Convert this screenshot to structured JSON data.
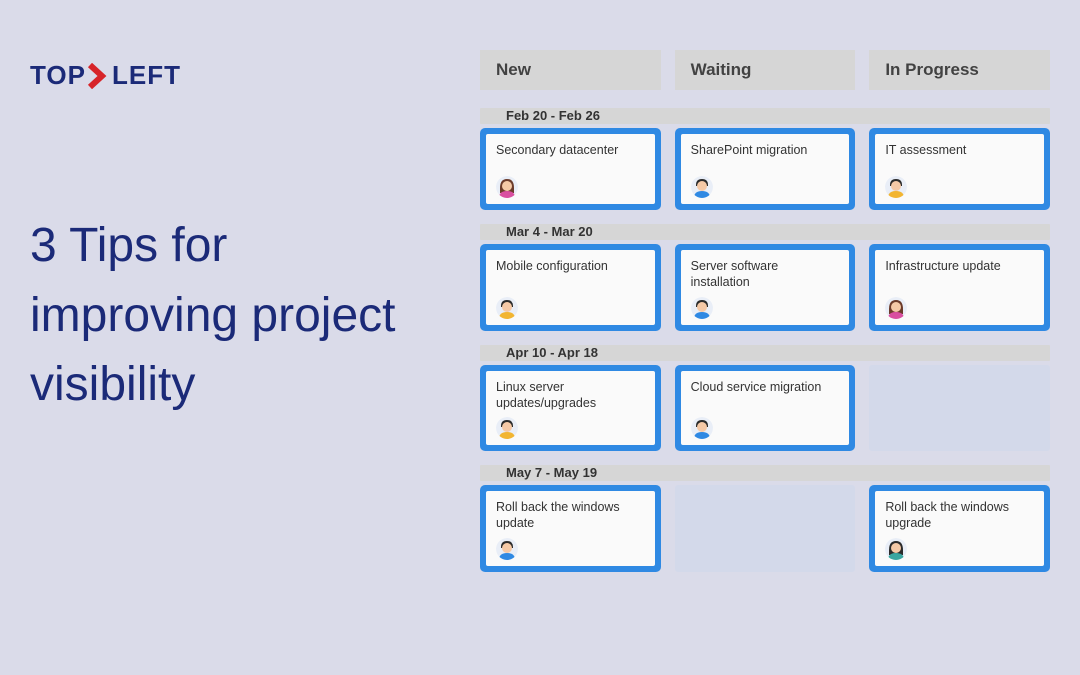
{
  "brand": {
    "top": "TOP",
    "left": "LEFT"
  },
  "headline": "3 Tips for improving project visibility",
  "columns": [
    "New",
    "Waiting",
    "In Progress"
  ],
  "avatars": {
    "woman_brown": {
      "hair": "#6b3b2a",
      "skin": "#f5c9a6",
      "shirt": "#d94fa0"
    },
    "man_blue": {
      "hair": "#2b2b2b",
      "skin": "#f5c9a6",
      "shirt": "#2f89e3"
    },
    "man_yellow": {
      "hair": "#2b2b2b",
      "skin": "#f5c9a6",
      "shirt": "#f2b531"
    },
    "woman_teal": {
      "hair": "#2b2b2b",
      "skin": "#f5c9a6",
      "shirt": "#3aa6a0"
    }
  },
  "swimlanes": [
    {
      "label": "Feb 20 - Feb 26",
      "cards": [
        {
          "title": "Secondary datacenter",
          "avatar": "woman_brown"
        },
        {
          "title": "SharePoint migration",
          "avatar": "man_blue"
        },
        {
          "title": "IT assessment",
          "avatar": "man_yellow"
        }
      ]
    },
    {
      "label": "Mar 4 - Mar 20",
      "cards": [
        {
          "title": "Mobile configuration",
          "avatar": "man_yellow"
        },
        {
          "title": "Server software installation",
          "avatar": "man_blue"
        },
        {
          "title": "Infrastructure update",
          "avatar": "woman_brown"
        }
      ]
    },
    {
      "label": "Apr 10 - Apr 18",
      "cards": [
        {
          "title": "Linux server updates/upgrades",
          "avatar": "man_yellow"
        },
        {
          "title": "Cloud service migration",
          "avatar": "man_blue"
        },
        null
      ]
    },
    {
      "label": "May 7 - May 19",
      "cards": [
        {
          "title": "Roll back the windows update",
          "avatar": "man_blue"
        },
        null,
        {
          "title": "Roll back the windows upgrade",
          "avatar": "woman_teal"
        }
      ]
    }
  ]
}
